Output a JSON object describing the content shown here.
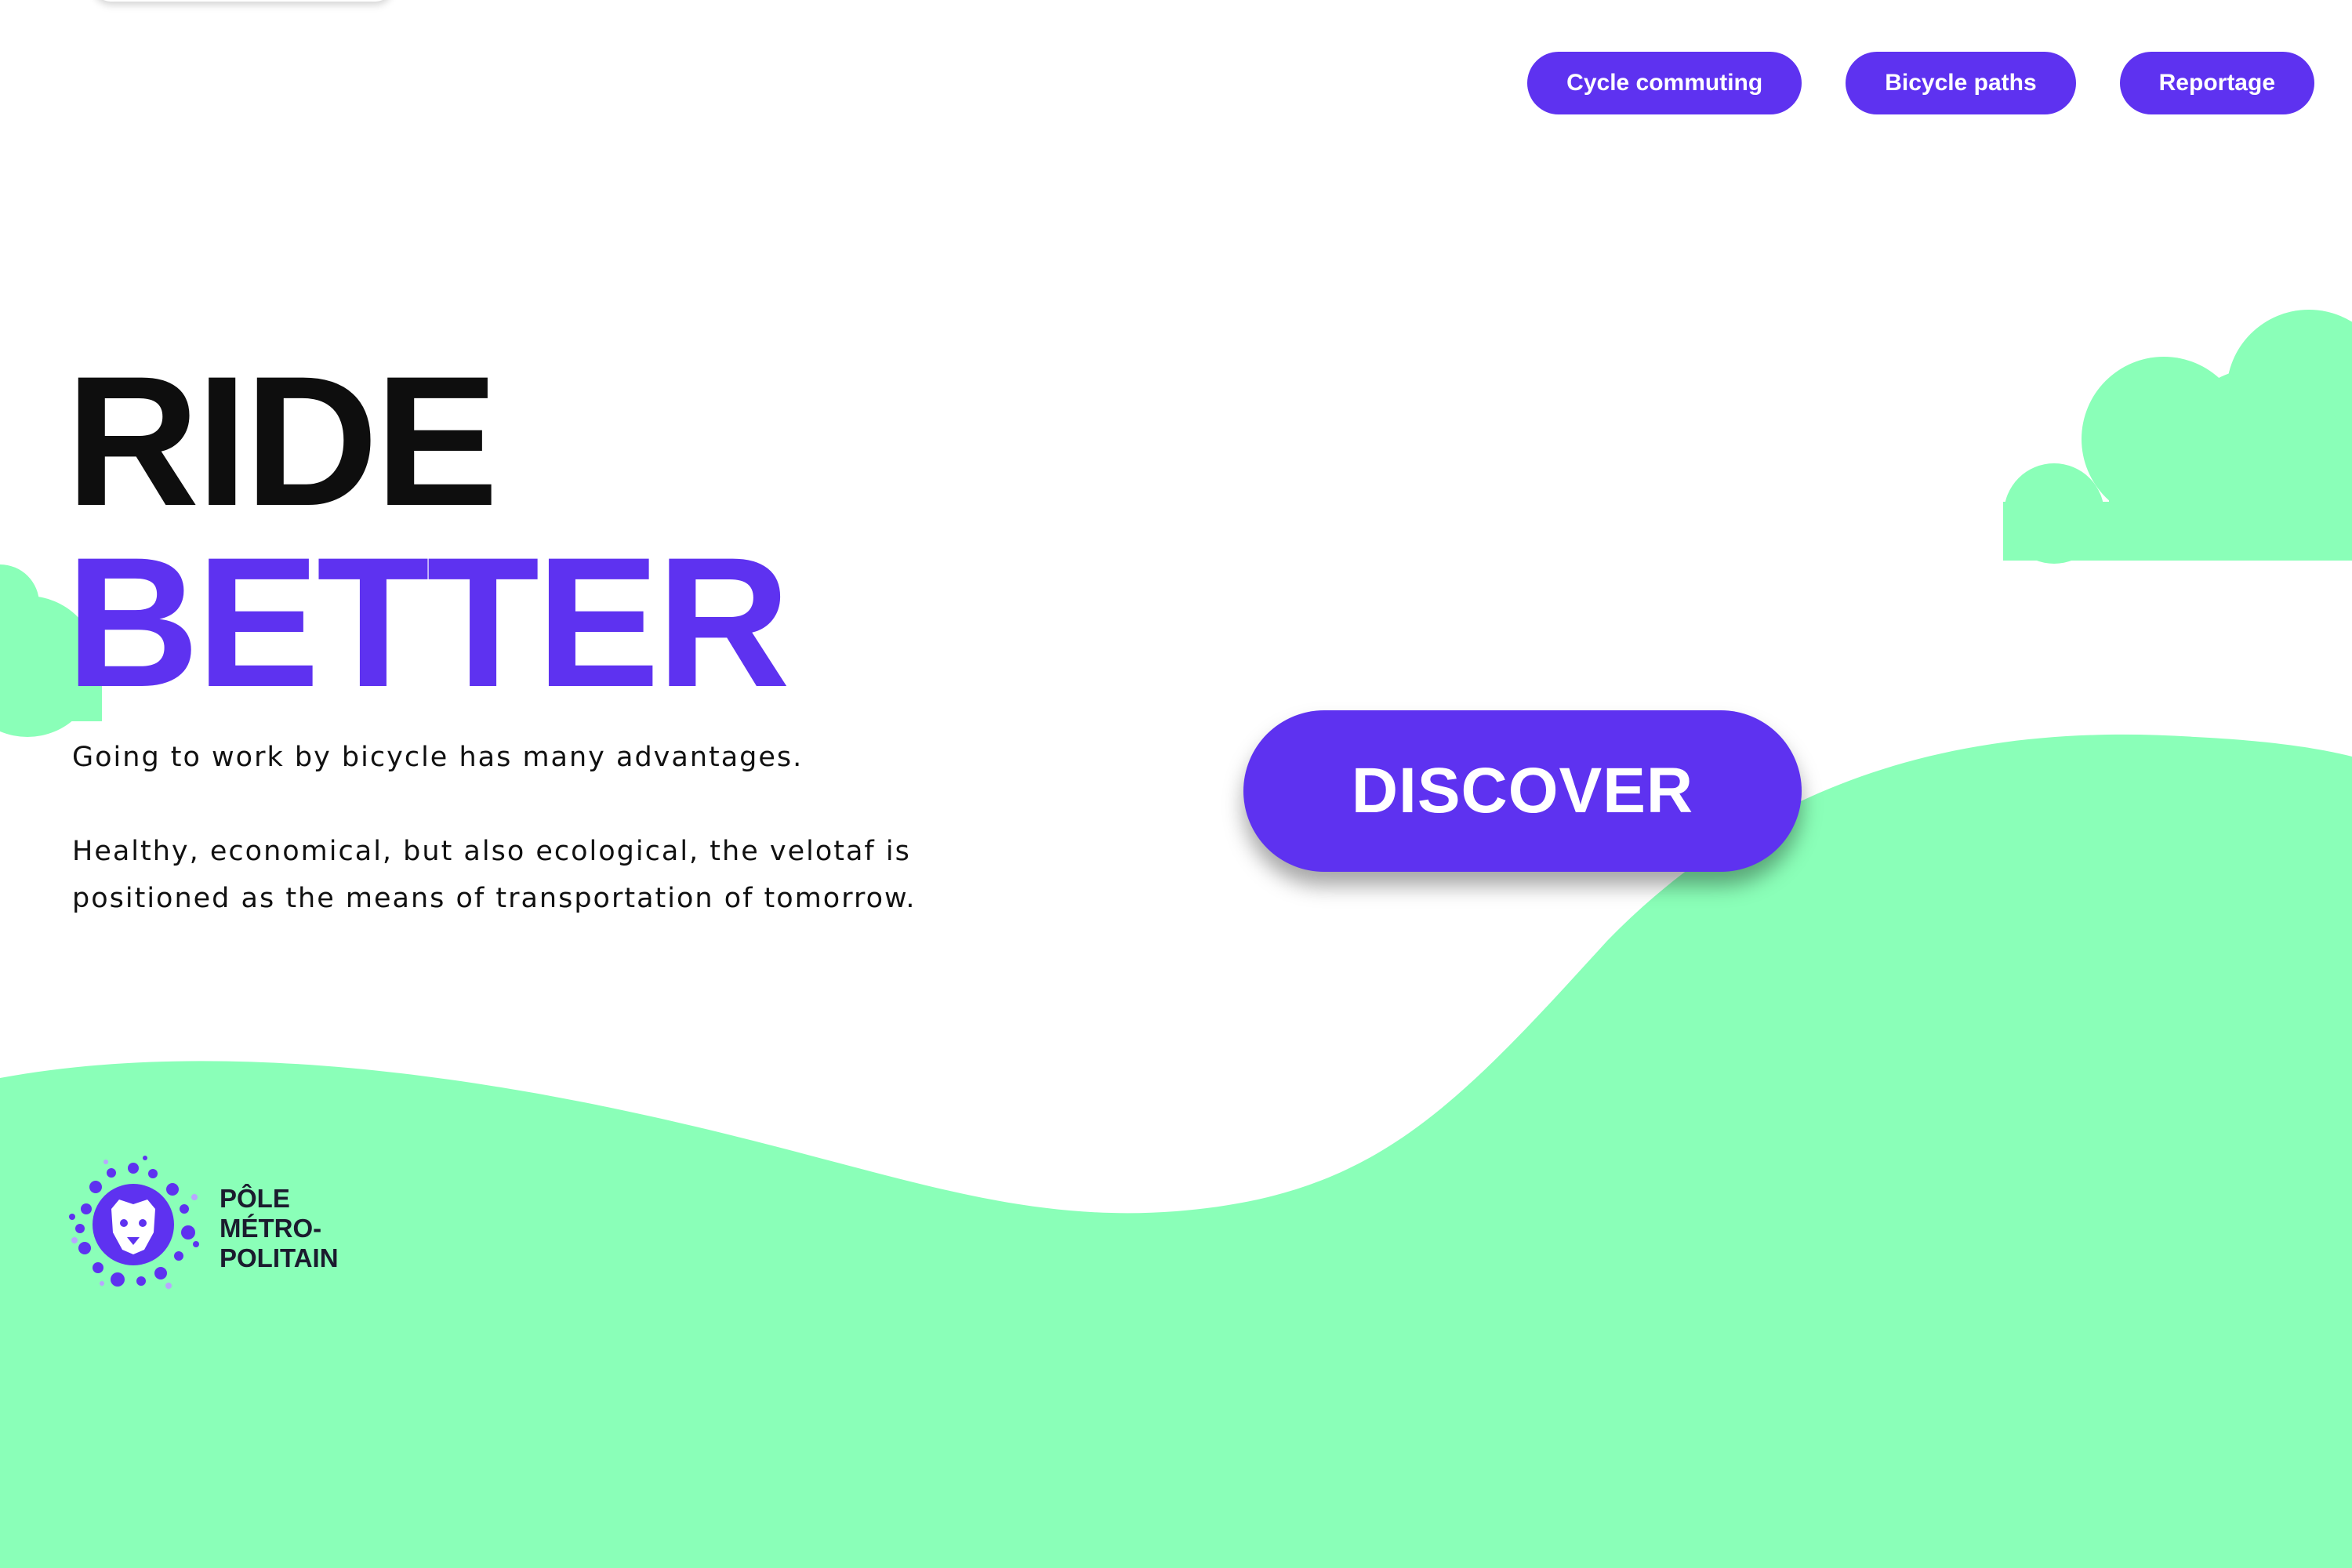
{
  "nav": {
    "items": [
      {
        "label": "Cycle commuting"
      },
      {
        "label": "Bicycle paths"
      },
      {
        "label": "Reportage"
      }
    ]
  },
  "hero": {
    "line1": "RIDE",
    "line2": "BETTER",
    "paragraph1": "Going to work by bicycle has many advantages.",
    "paragraph2": "Healthy, economical, but also ecological, the velotaf is positioned as the means of transportation of tomorrow.",
    "cta_label": "DISCOVER"
  },
  "logo": {
    "line1": "PÔLE",
    "line2": "MÉTRO-",
    "line3": "POLITAIN",
    "icon": "lion-icon"
  },
  "colors": {
    "accent": "#5e32f0",
    "green": "#8affb8",
    "text": "#0e0e0e",
    "background": "#ffffff"
  }
}
